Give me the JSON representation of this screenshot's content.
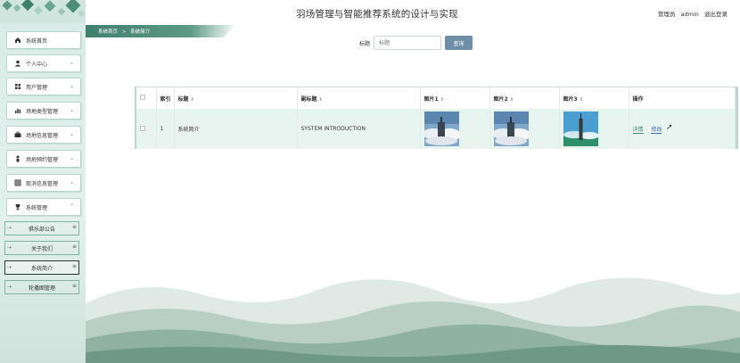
{
  "header": {
    "title": "羽场管理与智能推荐系统的设计与实现",
    "user_role": "管理员",
    "username": "admin",
    "logout_label": "退出登录"
  },
  "breadcrumb": {
    "home": "系统首页",
    "separator": ">",
    "current": "系统简介"
  },
  "sidebar": {
    "items": [
      {
        "label": "系统首页",
        "icon": "home-icon"
      },
      {
        "label": "个人中心",
        "icon": "user-icon"
      },
      {
        "label": "用户管理",
        "icon": "grid-icon"
      },
      {
        "label": "场地类型管理",
        "icon": "chart-icon"
      },
      {
        "label": "场地信息管理",
        "icon": "briefcase-icon"
      },
      {
        "label": "场地预约管理",
        "icon": "person-icon"
      },
      {
        "label": "取消信息管理",
        "icon": "table-icon"
      },
      {
        "label": "系统管理",
        "icon": "trophy-icon"
      }
    ],
    "sub_items": [
      {
        "label": "俱乐部公告"
      },
      {
        "label": "关于我们"
      },
      {
        "label": "系统简介"
      },
      {
        "label": "轮播图管理"
      }
    ]
  },
  "search": {
    "label": "标题",
    "placeholder": "标题",
    "button_label": "查询"
  },
  "table": {
    "columns": [
      "索引",
      "标题",
      "副标题",
      "图片1",
      "图片2",
      "图片3",
      "操作"
    ],
    "rows": [
      {
        "index": "1",
        "title": "系统简介",
        "subtitle": "SYSTEM INTRODUCTION",
        "detail_label": "详情",
        "edit_label": "修改"
      }
    ]
  },
  "colors": {
    "accent": "#3f7f6c",
    "search_button": "#6f8fa8",
    "row_highlight": "#e8f4ef"
  }
}
